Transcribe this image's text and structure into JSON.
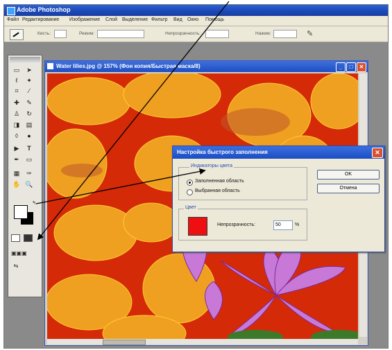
{
  "app": {
    "title": "Adobe Photoshop"
  },
  "menu": [
    "Файл",
    "Редактирование",
    "Изображение",
    "Слой",
    "Выделение",
    "Фильтр",
    "Вид",
    "Окно",
    "Помощь"
  ],
  "options": {
    "brush_label": "Кисть:",
    "mode_label": "Режим:",
    "opacity_label": "Непрозрачность:",
    "flow_label": "Нажим:"
  },
  "document": {
    "title": "Water lilies.jpg @ 157% (Фон копия/Быстрая маска/8)"
  },
  "dialog": {
    "title": "Настройка быстрого заполнения",
    "indicates_label": "Индикаторы цвета",
    "radio_1": "Заполненная область",
    "radio_2": "Выбранная область",
    "color_label": "Цвет",
    "opacity_label": "Непрозрачность:",
    "opacity_value": "50",
    "percent": "%",
    "ok": "OK",
    "cancel": "Отмена",
    "selected": "masked-areas",
    "color": "#ee1010"
  }
}
